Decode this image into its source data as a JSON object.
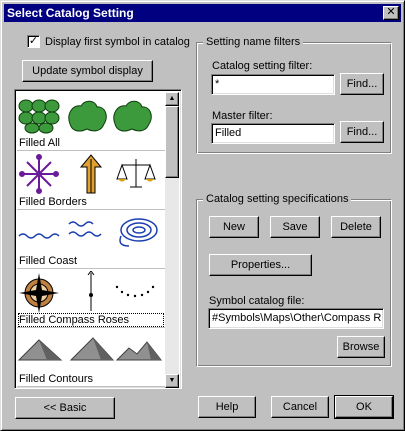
{
  "window": {
    "title": "Select Catalog Setting",
    "close_label": "✕"
  },
  "options": {
    "display_first_symbol_label": "Display first symbol in catalog",
    "display_first_symbol_checked": true,
    "checkmark": "✓"
  },
  "update_button_label": "Update symbol display",
  "catalog_list": {
    "items": [
      {
        "label": "Filled All"
      },
      {
        "label": "Filled Borders"
      },
      {
        "label": "Filled Coast"
      },
      {
        "label": "Filled Compass Roses"
      },
      {
        "label": "Filled Contours"
      }
    ],
    "scroll_up_glyph": "▲",
    "scroll_down_glyph": "▼"
  },
  "filters": {
    "group_title": "Setting name filters",
    "catalog_filter_label": "Catalog setting filter:",
    "catalog_filter_value": "*",
    "catalog_find_label": "Find...",
    "master_filter_label": "Master filter:",
    "master_filter_value": "Filled",
    "master_find_label": "Find..."
  },
  "specs": {
    "group_title": "Catalog setting specifications",
    "new_label": "New",
    "save_label": "Save",
    "delete_label": "Delete",
    "properties_label": "Properties...",
    "symbol_file_label": "Symbol catalog file:",
    "symbol_file_value": "#Symbols\\Maps\\Other\\Compass R",
    "browse_label": "Browse"
  },
  "footer": {
    "basic_label": "<< Basic",
    "help_label": "Help",
    "cancel_label": "Cancel",
    "ok_label": "OK"
  }
}
